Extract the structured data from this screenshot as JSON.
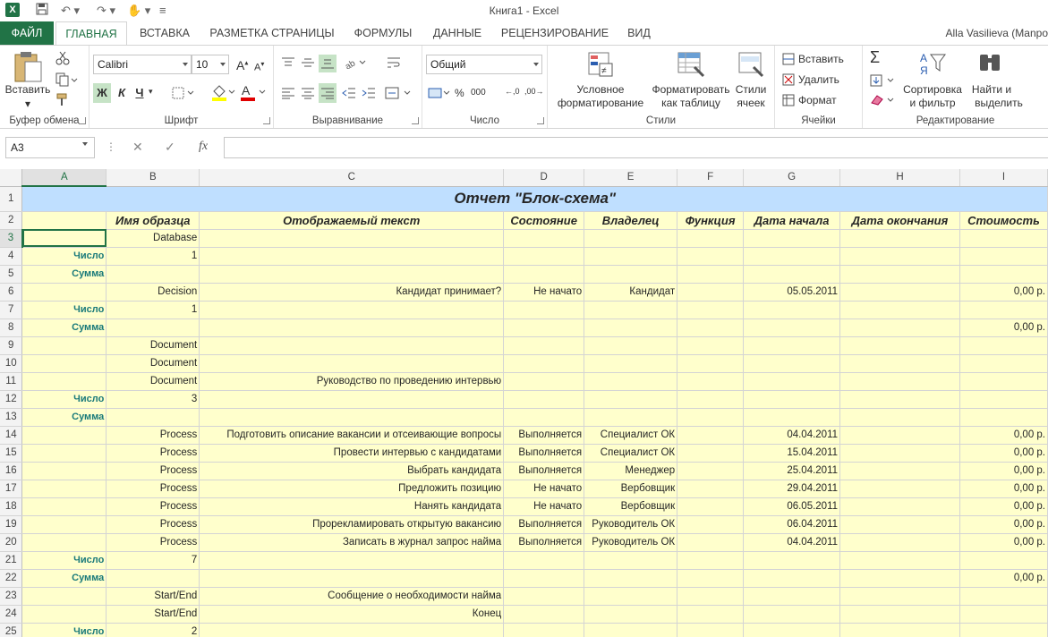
{
  "window": {
    "title": "Книга1 - Excel",
    "user": "Alla Vasilieva (Manpo"
  },
  "tabs": [
    "ФАЙЛ",
    "ГЛАВНАЯ",
    "ВСТАВКА",
    "РАЗМЕТКА СТРАНИЦЫ",
    "ФОРМУЛЫ",
    "ДАННЫЕ",
    "РЕЦЕНЗИРОВАНИЕ",
    "ВИД"
  ],
  "active_tab": "ГЛАВНАЯ",
  "ribbon": {
    "clipboard": {
      "paste": "Вставить",
      "label": "Буфер обмена"
    },
    "font": {
      "name": "Calibri",
      "size": "10",
      "bold": "Ж",
      "italic": "К",
      "underline": "Ч",
      "label": "Шрифт"
    },
    "alignment": {
      "label": "Выравнивание"
    },
    "number": {
      "format": "Общий",
      "label": "Число"
    },
    "styles": {
      "cond1": "Условное",
      "cond2": "форматирование",
      "table1": "Форматировать",
      "table2": "как таблицу",
      "cell1": "Стили",
      "cell2": "ячеек",
      "label": "Стили"
    },
    "cells": {
      "insert": "Вставить",
      "delete": "Удалить",
      "format": "Формат",
      "label": "Ячейки"
    },
    "editing": {
      "sort1": "Сортировка",
      "sort2": "и фильтр",
      "find1": "Найти и",
      "find2": "выделить",
      "label": "Редактирование",
      "sigma": "Σ"
    }
  },
  "formula_bar": {
    "name_box": "A3",
    "fx": "fx",
    "value": ""
  },
  "columns": [
    "A",
    "B",
    "C",
    "D",
    "E",
    "F",
    "G",
    "H",
    "I"
  ],
  "selected_column": "A",
  "selected_row": 3,
  "sheet": {
    "title": "Отчет \"Блок-схема\"",
    "headers": [
      "",
      "Имя образца",
      "Отображаемый текст",
      "Состояние",
      "Владелец",
      "Функция",
      "Дата начала",
      "Дата окончания",
      "Стоимость"
    ],
    "rows": [
      {
        "n": "3",
        "a": "",
        "b": "Database",
        "c": "",
        "d": "",
        "e": "",
        "f": "",
        "g": "",
        "h": "",
        "i": ""
      },
      {
        "n": "4",
        "a": "Число",
        "b": "1",
        "c": "",
        "d": "",
        "e": "",
        "f": "",
        "g": "",
        "h": "",
        "i": ""
      },
      {
        "n": "5",
        "a": "Сумма",
        "b": "",
        "c": "",
        "d": "",
        "e": "",
        "f": "",
        "g": "",
        "h": "",
        "i": ""
      },
      {
        "n": "6",
        "a": "",
        "b": "Decision",
        "c": "Кандидат принимает?",
        "d": "Не начато",
        "e": "Кандидат",
        "f": "",
        "g": "05.05.2011",
        "h": "",
        "i": "0,00 р."
      },
      {
        "n": "7",
        "a": "Число",
        "b": "1",
        "c": "",
        "d": "",
        "e": "",
        "f": "",
        "g": "",
        "h": "",
        "i": ""
      },
      {
        "n": "8",
        "a": "Сумма",
        "b": "",
        "c": "",
        "d": "",
        "e": "",
        "f": "",
        "g": "",
        "h": "",
        "i": "0,00 р."
      },
      {
        "n": "9",
        "a": "",
        "b": "Document",
        "c": "",
        "d": "",
        "e": "",
        "f": "",
        "g": "",
        "h": "",
        "i": ""
      },
      {
        "n": "10",
        "a": "",
        "b": "Document",
        "c": "",
        "d": "",
        "e": "",
        "f": "",
        "g": "",
        "h": "",
        "i": ""
      },
      {
        "n": "11",
        "a": "",
        "b": "Document",
        "c": "Руководство по проведению интервью",
        "d": "",
        "e": "",
        "f": "",
        "g": "",
        "h": "",
        "i": ""
      },
      {
        "n": "12",
        "a": "Число",
        "b": "3",
        "c": "",
        "d": "",
        "e": "",
        "f": "",
        "g": "",
        "h": "",
        "i": ""
      },
      {
        "n": "13",
        "a": "Сумма",
        "b": "",
        "c": "",
        "d": "",
        "e": "",
        "f": "",
        "g": "",
        "h": "",
        "i": ""
      },
      {
        "n": "14",
        "a": "",
        "b": "Process",
        "c": "Подготовить описание вакансии и отсеивающие вопросы",
        "d": "Выполняется",
        "e": "Специалист ОК",
        "f": "",
        "g": "04.04.2011",
        "h": "",
        "i": "0,00 р."
      },
      {
        "n": "15",
        "a": "",
        "b": "Process",
        "c": "Провести интервью с кандидатами",
        "d": "Выполняется",
        "e": "Специалист ОК",
        "f": "",
        "g": "15.04.2011",
        "h": "",
        "i": "0,00 р."
      },
      {
        "n": "16",
        "a": "",
        "b": "Process",
        "c": "Выбрать кандидата",
        "d": "Выполняется",
        "e": "Менеджер",
        "f": "",
        "g": "25.04.2011",
        "h": "",
        "i": "0,00 р."
      },
      {
        "n": "17",
        "a": "",
        "b": "Process",
        "c": "Предложить позицию",
        "d": "Не начато",
        "e": "Вербовщик",
        "f": "",
        "g": "29.04.2011",
        "h": "",
        "i": "0,00 р."
      },
      {
        "n": "18",
        "a": "",
        "b": "Process",
        "c": "Нанять кандидата",
        "d": "Не начато",
        "e": "Вербовщик",
        "f": "",
        "g": "06.05.2011",
        "h": "",
        "i": "0,00 р."
      },
      {
        "n": "19",
        "a": "",
        "b": "Process",
        "c": "Прорекламировать открытую вакансию",
        "d": "Выполняется",
        "e": "Руководитель ОК",
        "f": "",
        "g": "06.04.2011",
        "h": "",
        "i": "0,00 р."
      },
      {
        "n": "20",
        "a": "",
        "b": "Process",
        "c": "Записать в журнал запрос найма",
        "d": "Выполняется",
        "e": "Руководитель ОК",
        "f": "",
        "g": "04.04.2011",
        "h": "",
        "i": "0,00 р."
      },
      {
        "n": "21",
        "a": "Число",
        "b": "7",
        "c": "",
        "d": "",
        "e": "",
        "f": "",
        "g": "",
        "h": "",
        "i": ""
      },
      {
        "n": "22",
        "a": "Сумма",
        "b": "",
        "c": "",
        "d": "",
        "e": "",
        "f": "",
        "g": "",
        "h": "",
        "i": "0,00 р."
      },
      {
        "n": "23",
        "a": "",
        "b": "Start/End",
        "c": "Сообщение о необходимости найма",
        "d": "",
        "e": "",
        "f": "",
        "g": "",
        "h": "",
        "i": ""
      },
      {
        "n": "24",
        "a": "",
        "b": "Start/End",
        "c": "Конец",
        "d": "",
        "e": "",
        "f": "",
        "g": "",
        "h": "",
        "i": ""
      },
      {
        "n": "25",
        "a": "Число",
        "b": "2",
        "c": "",
        "d": "",
        "e": "",
        "f": "",
        "g": "",
        "h": "",
        "i": ""
      }
    ]
  },
  "colors": {
    "accent": "#217346",
    "title_fill": "#bfdfff",
    "cell_fill": "#ffffcc",
    "label_text": "#1a7a7a"
  }
}
